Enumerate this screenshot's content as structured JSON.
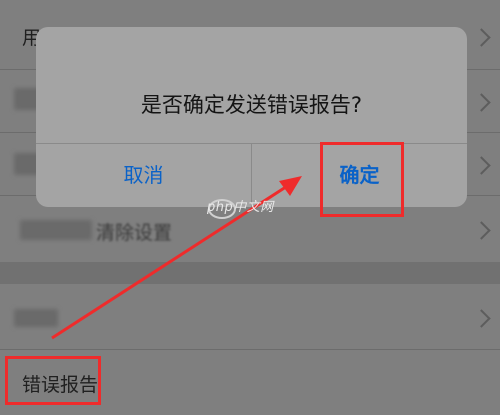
{
  "list": {
    "row1_label": "用户须知",
    "row4_label": "清除设置",
    "row_error_label": "错误报告"
  },
  "dialog": {
    "title": "是否确定发送错误报告?",
    "cancel_label": "取消",
    "confirm_label": "确定"
  },
  "watermark": {
    "text": "php中文网"
  },
  "colors": {
    "annotation_red": "#ef2b2b",
    "button_blue": "#0a62c8"
  }
}
